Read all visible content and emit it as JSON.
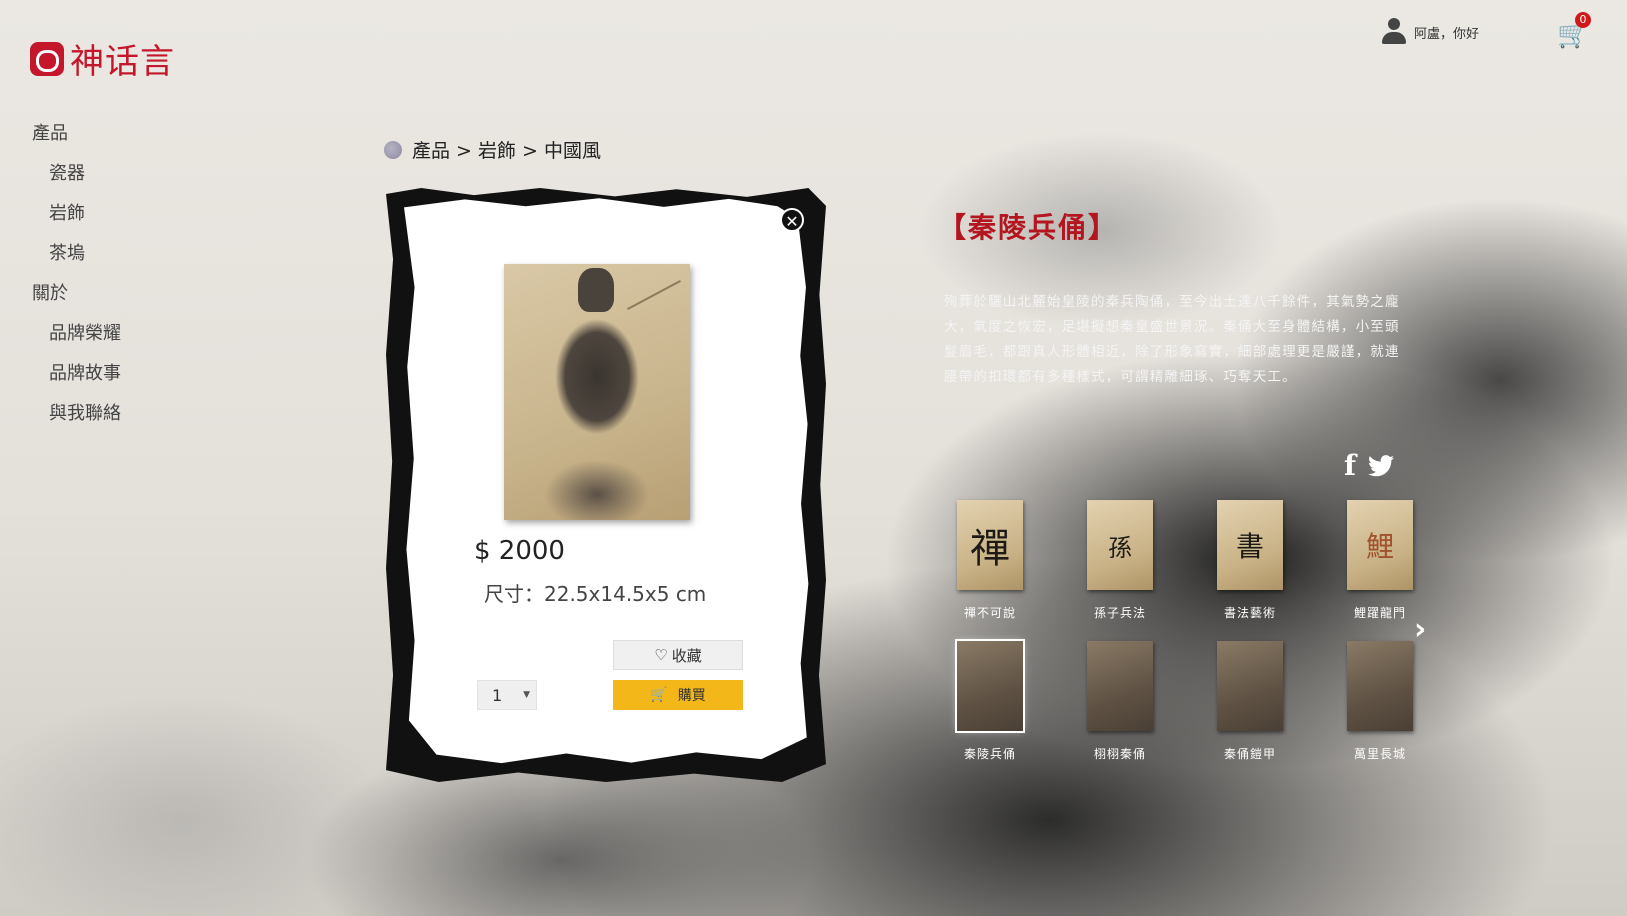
{
  "brand": {
    "name": "神话言",
    "accent": "#c4172c"
  },
  "header": {
    "user_greeting": "阿盧，你好",
    "cart_count": "0"
  },
  "sidebar": {
    "items": [
      {
        "label": "產品",
        "level": 1
      },
      {
        "label": "瓷器",
        "level": 2
      },
      {
        "label": "岩飾",
        "level": 2
      },
      {
        "label": "茶塢",
        "level": 2
      },
      {
        "label": "關於",
        "level": 1
      },
      {
        "label": "品牌榮耀",
        "level": 2
      },
      {
        "label": "品牌故事",
        "level": 2
      },
      {
        "label": "與我聯絡",
        "level": 2
      }
    ]
  },
  "breadcrumb": {
    "text": "產品 > 岩飾 > 中國風"
  },
  "product": {
    "price": "$ 2000",
    "size": "尺寸：22.5x14.5x5 cm",
    "quantity": "1",
    "favorite_label": "收藏",
    "buy_label": "購買",
    "title": "【秦陵兵俑】",
    "description": "殉葬於驪山北麓始皇陵的秦兵陶俑，至今出土達八千餘件，其氣勢之龐大，氣度之恢宏，足堪擬想秦皇盛世景況。秦俑大至身體結構，小至頭髮眉毛，都跟真人形體相近，除了形象寫實，細部處理更是嚴謹，就連腰帶的扣環都有多種樣式，可謂精雕細琢、巧奪天工。"
  },
  "thumbnails": [
    {
      "label": "禪不可說",
      "glyph": "禪",
      "tone": "light",
      "selected": false
    },
    {
      "label": "孫子兵法",
      "glyph": "孫",
      "tone": "light",
      "selected": false
    },
    {
      "label": "書法藝術",
      "glyph": "書",
      "tone": "light",
      "selected": false
    },
    {
      "label": "鯉躍龍門",
      "glyph": "鯉",
      "tone": "light",
      "selected": false
    },
    {
      "label": "秦陵兵俑",
      "glyph": "",
      "tone": "dark",
      "selected": true
    },
    {
      "label": "栩栩秦俑",
      "glyph": "",
      "tone": "dark",
      "selected": false
    },
    {
      "label": "秦俑鎧甲",
      "glyph": "",
      "tone": "dark",
      "selected": false
    },
    {
      "label": "萬里長城",
      "glyph": "",
      "tone": "dark",
      "selected": false
    }
  ],
  "icons": {
    "user": "user-icon",
    "cart": "cart-icon",
    "close": "close-icon",
    "heart": "heart-icon",
    "cart_small": "cart-icon",
    "facebook": "facebook-icon",
    "twitter": "twitter-icon",
    "next": "chevron-right-icon"
  }
}
